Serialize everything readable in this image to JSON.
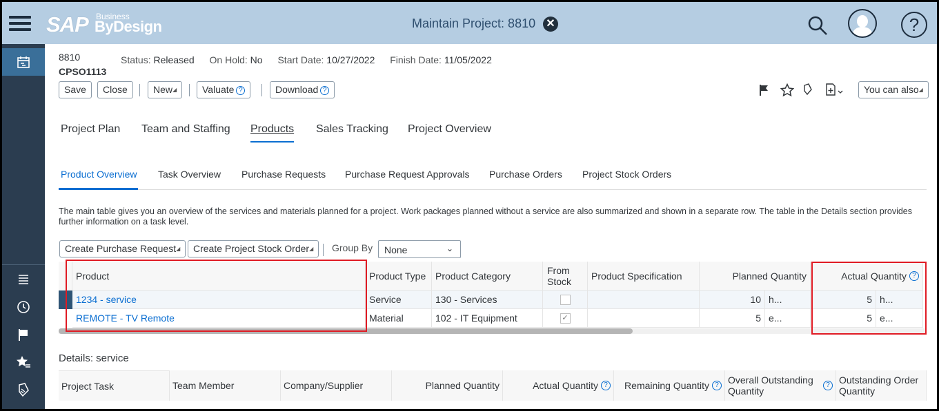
{
  "shell": {
    "logo_main": "SAP",
    "logo_business": "Business",
    "logo_bydesign": "ByDesign",
    "title": "Maintain Project: 8810"
  },
  "header": {
    "project_id": "8810",
    "project_sub": "CPSO1113",
    "status_label": "Status:",
    "status_value": "Released",
    "onhold_label": "On Hold:",
    "onhold_value": "No",
    "start_label": "Start Date:",
    "start_value": "10/27/2022",
    "finish_label": "Finish Date:",
    "finish_value": "11/05/2022"
  },
  "toolbar": {
    "save": "Save",
    "close": "Close",
    "new": "New",
    "valuate": "Valuate",
    "download": "Download",
    "you_can_also": "You can also"
  },
  "tabs": [
    "Project Plan",
    "Team and Staffing",
    "Products",
    "Sales Tracking",
    "Project Overview"
  ],
  "subtabs": [
    "Product Overview",
    "Task Overview",
    "Purchase Requests",
    "Purchase Request Approvals",
    "Purchase Orders",
    "Project Stock Orders"
  ],
  "description": "The main table gives you an overview of the services and materials planned for a project. Work packages planned without a service are also summarized and shown in a separate row. The table in the Details section provides further information on a task level.",
  "table_toolbar": {
    "create_pr": "Create Purchase Request",
    "create_pso": "Create Project Stock Order",
    "group_by_label": "Group By",
    "group_by_value": "None"
  },
  "main_table": {
    "headers": {
      "product": "Product",
      "type": "Product Type",
      "category": "Product Category",
      "from_stock": "From Stock",
      "spec": "Product Specification",
      "planned": "Planned Quantity",
      "actual": "Actual Quantity"
    },
    "rows": [
      {
        "product": "1234 - service",
        "type": "Service",
        "category": "130 - Services",
        "from_stock": false,
        "spec": "",
        "planned": "10",
        "planned_unit": "h...",
        "actual": "5",
        "actual_unit": "h..."
      },
      {
        "product": "REMOTE - TV Remote",
        "type": "Material",
        "category": "102 - IT Equipment",
        "from_stock": true,
        "spec": "",
        "planned": "5",
        "planned_unit": "e...",
        "actual": "5",
        "actual_unit": "e..."
      }
    ]
  },
  "details": {
    "title": "Details: service",
    "headers": {
      "task": "Project Task",
      "member": "Team Member",
      "company": "Company/Supplier",
      "planned": "Planned Quantity",
      "actual": "Actual Quantity",
      "remaining": "Remaining Quantity",
      "overall": "Overall Outstanding Quantity",
      "order": "Outstanding Order Quantity"
    }
  },
  "colors": {
    "shell_bg": "#b5cde2",
    "rail_bg": "#2b3d50",
    "link": "#0a6ed1",
    "highlight": "#e01b24"
  }
}
